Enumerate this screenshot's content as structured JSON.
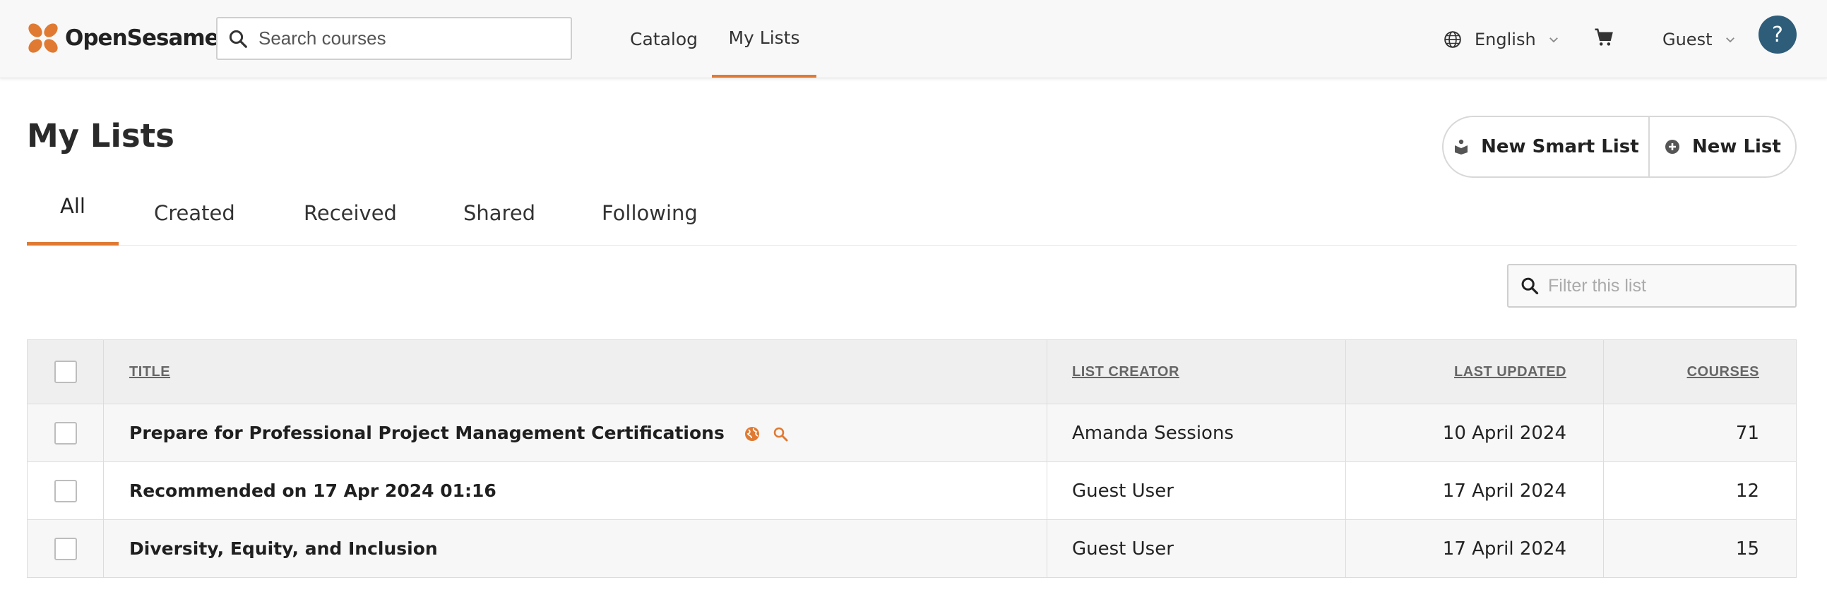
{
  "brand": {
    "name": "OpenSesame",
    "accent": "#e07a32",
    "help_bg": "#2e5d7a"
  },
  "search": {
    "placeholder": "Search courses"
  },
  "nav": {
    "catalog": "Catalog",
    "my_lists": "My Lists"
  },
  "language": {
    "label": "English"
  },
  "user": {
    "label": "Guest"
  },
  "help": {
    "label": "?"
  },
  "page": {
    "title": "My Lists"
  },
  "actions": {
    "new_smart_list": "New Smart List",
    "new_list": "New List"
  },
  "tabs": [
    "All",
    "Created",
    "Received",
    "Shared",
    "Following"
  ],
  "filter": {
    "placeholder": "Filter this list"
  },
  "table": {
    "headers": {
      "title": "TITLE",
      "creator": "LIST CREATOR",
      "updated": "LAST UPDATED",
      "courses": "COURSES"
    },
    "rows": [
      {
        "title": "Prepare for Professional Project Management Certifications",
        "creator": "Amanda Sessions",
        "updated": "10 April 2024",
        "courses": "71",
        "icons": [
          "public-globe-icon",
          "smart-search-icon"
        ]
      },
      {
        "title": "Recommended on 17 Apr 2024 01:16",
        "creator": "Guest User",
        "updated": "17 April 2024",
        "courses": "12",
        "icons": []
      },
      {
        "title": "Diversity, Equity, and Inclusion",
        "creator": "Guest User",
        "updated": "17 April 2024",
        "courses": "15",
        "icons": []
      }
    ]
  }
}
